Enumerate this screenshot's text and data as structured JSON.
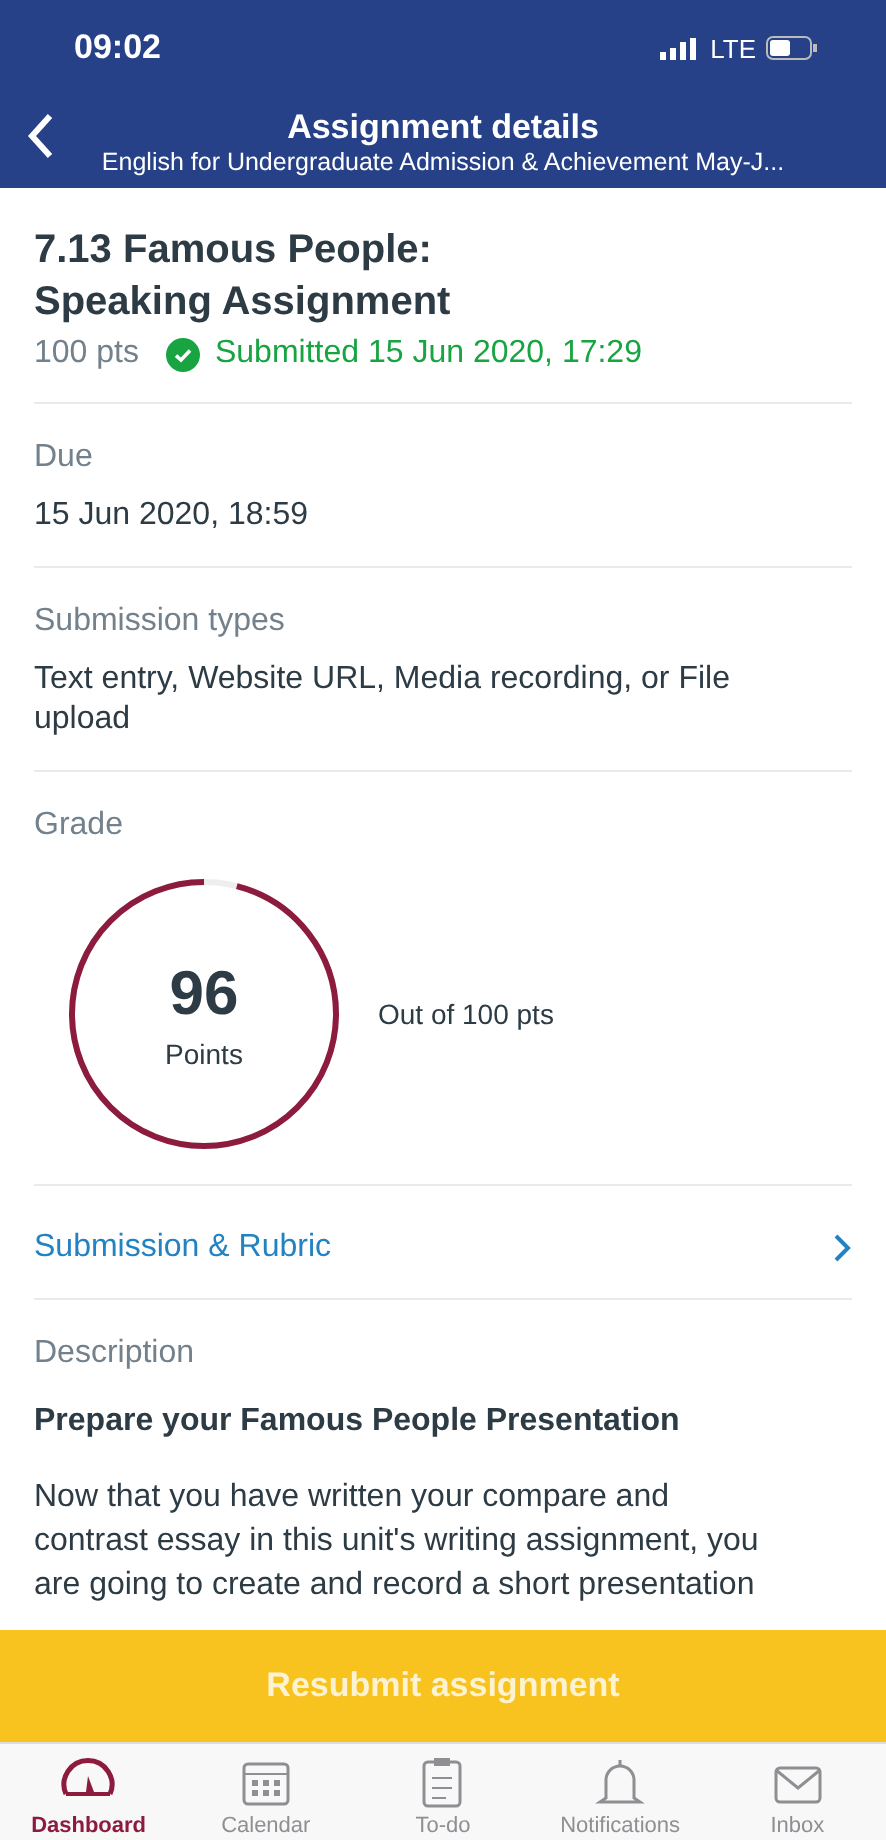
{
  "status_bar": {
    "time": "09:02",
    "network": "LTE"
  },
  "header": {
    "title": "Assignment details",
    "subtitle": "English for Undergraduate Admission & Achievement May-J..."
  },
  "assignment": {
    "title": "7.13 Famous People: Speaking Assignment",
    "points": "100 pts",
    "submitted": true,
    "status": "Submitted 15 Jun 2020, 17:29"
  },
  "sections": [
    {
      "label": "Due",
      "value": "15 Jun 2020, 18:59"
    },
    {
      "label": "Submission types",
      "value": "Text entry, Website URL, Media recording, or File upload"
    }
  ],
  "grade": {
    "label": "Grade",
    "score": "96",
    "unit": "Points",
    "level": 0.96,
    "out_of": "Out of 100 pts"
  },
  "link": "Submission & Rubric",
  "description": {
    "label": "Description",
    "heading": "Prepare your Famous People Presentation",
    "text": "Now that you have written your compare and contrast essay in this unit's writing assignment, you are going to create and record a short presentation"
  },
  "action": "Resubmit assignment",
  "tabs": [
    {
      "label": "Dashboard",
      "selected": true
    },
    {
      "label": "Calendar",
      "selected": false
    },
    {
      "label": "To-do",
      "selected": false
    },
    {
      "label": "Notifications",
      "selected": false
    },
    {
      "label": "Inbox",
      "selected": false
    }
  ]
}
